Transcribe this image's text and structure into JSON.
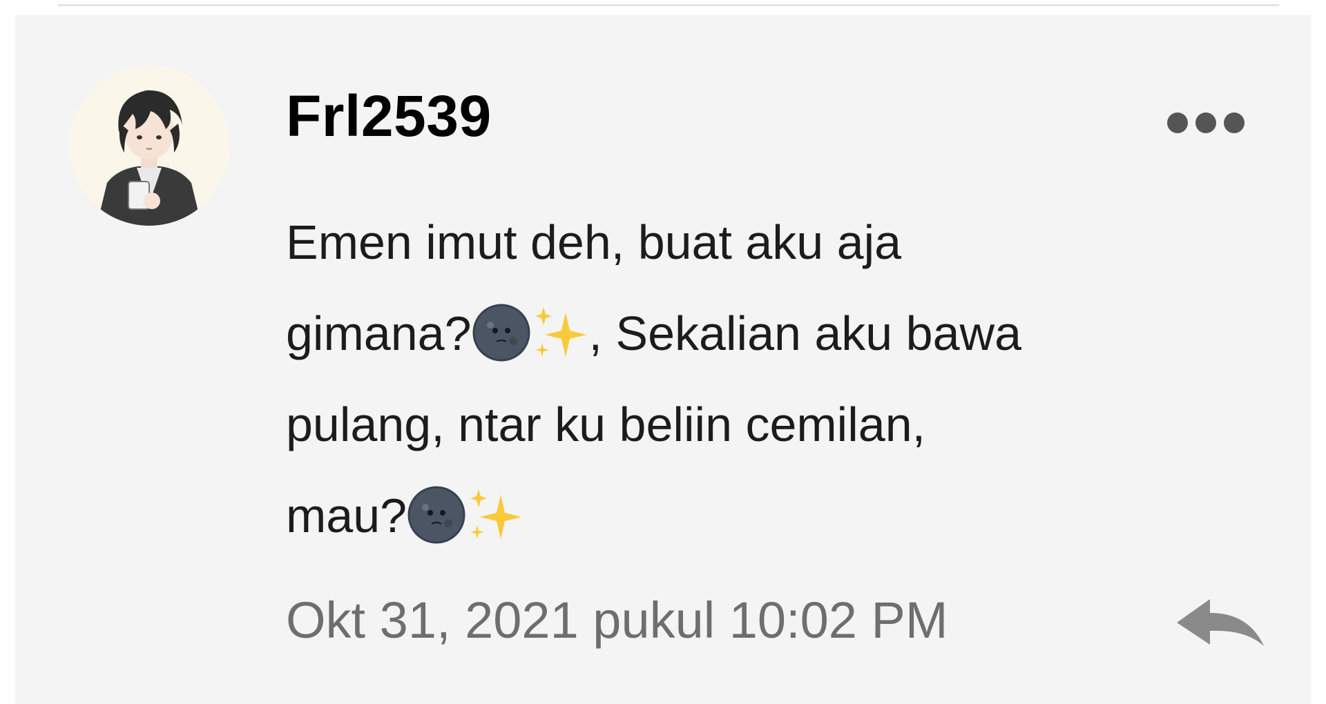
{
  "comment": {
    "username": "Frl2539",
    "text_lines": [
      "Emen imut deh, buat aku aja",
      "gimana?",
      ", Sekalian aku bawa",
      "pulang, ntar ku beliin cemilan,",
      "mau?"
    ],
    "timestamp": "Okt 31, 2021 pukul 10:02 PM",
    "icons": {
      "avatar": "user-avatar-illustration",
      "more": "more-options-icon",
      "emoji_moon": "new-moon-face-emoji",
      "emoji_sparkles": "sparkles-emoji",
      "reply": "reply-arrow-icon"
    }
  },
  "colors": {
    "card_background": "#f4f4f4",
    "username": "#000000",
    "body_text": "#1c1c1c",
    "timestamp": "#6e6e6e",
    "icon_gray": "#555555"
  }
}
